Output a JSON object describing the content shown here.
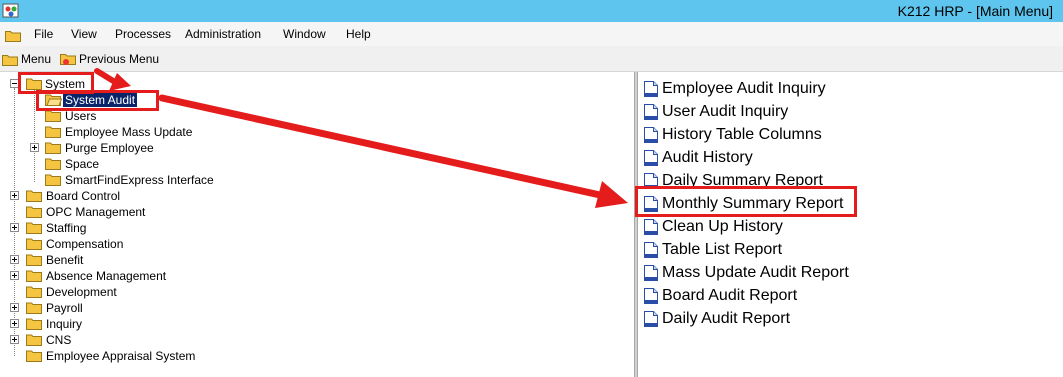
{
  "window": {
    "title": "K212 HRP - [Main Menu]"
  },
  "menubar": {
    "items": [
      "File",
      "View",
      "Processes",
      "Administration",
      "Window",
      "Help"
    ]
  },
  "toolbar": {
    "menu_label": "Menu",
    "previous_label": "Previous Menu"
  },
  "tree": {
    "system": "System",
    "system_children": [
      "System Audit",
      "Users",
      "Employee Mass Update",
      "Purge Employee",
      "Space",
      "SmartFindExpress Interface"
    ],
    "top_level": [
      "Board Control",
      "OPC Management",
      "Staffing",
      "Compensation",
      "Benefit",
      "Absence Management",
      "Development",
      "Payroll",
      "Inquiry",
      "CNS",
      "Employee Appraisal System"
    ]
  },
  "right_list": {
    "items": [
      "Employee Audit Inquiry",
      "User Audit Inquiry",
      "History Table Columns",
      "Audit History",
      "Daily Summary Report",
      "Monthly Summary Report",
      "Clean Up History",
      "Table List Report",
      "Mass Update Audit Report",
      "Board Audit Report",
      "Daily Audit Report"
    ]
  },
  "colors": {
    "titlebar": "#5ec6ee",
    "highlight_box": "#e41c1c",
    "selection": "#0a246a"
  }
}
